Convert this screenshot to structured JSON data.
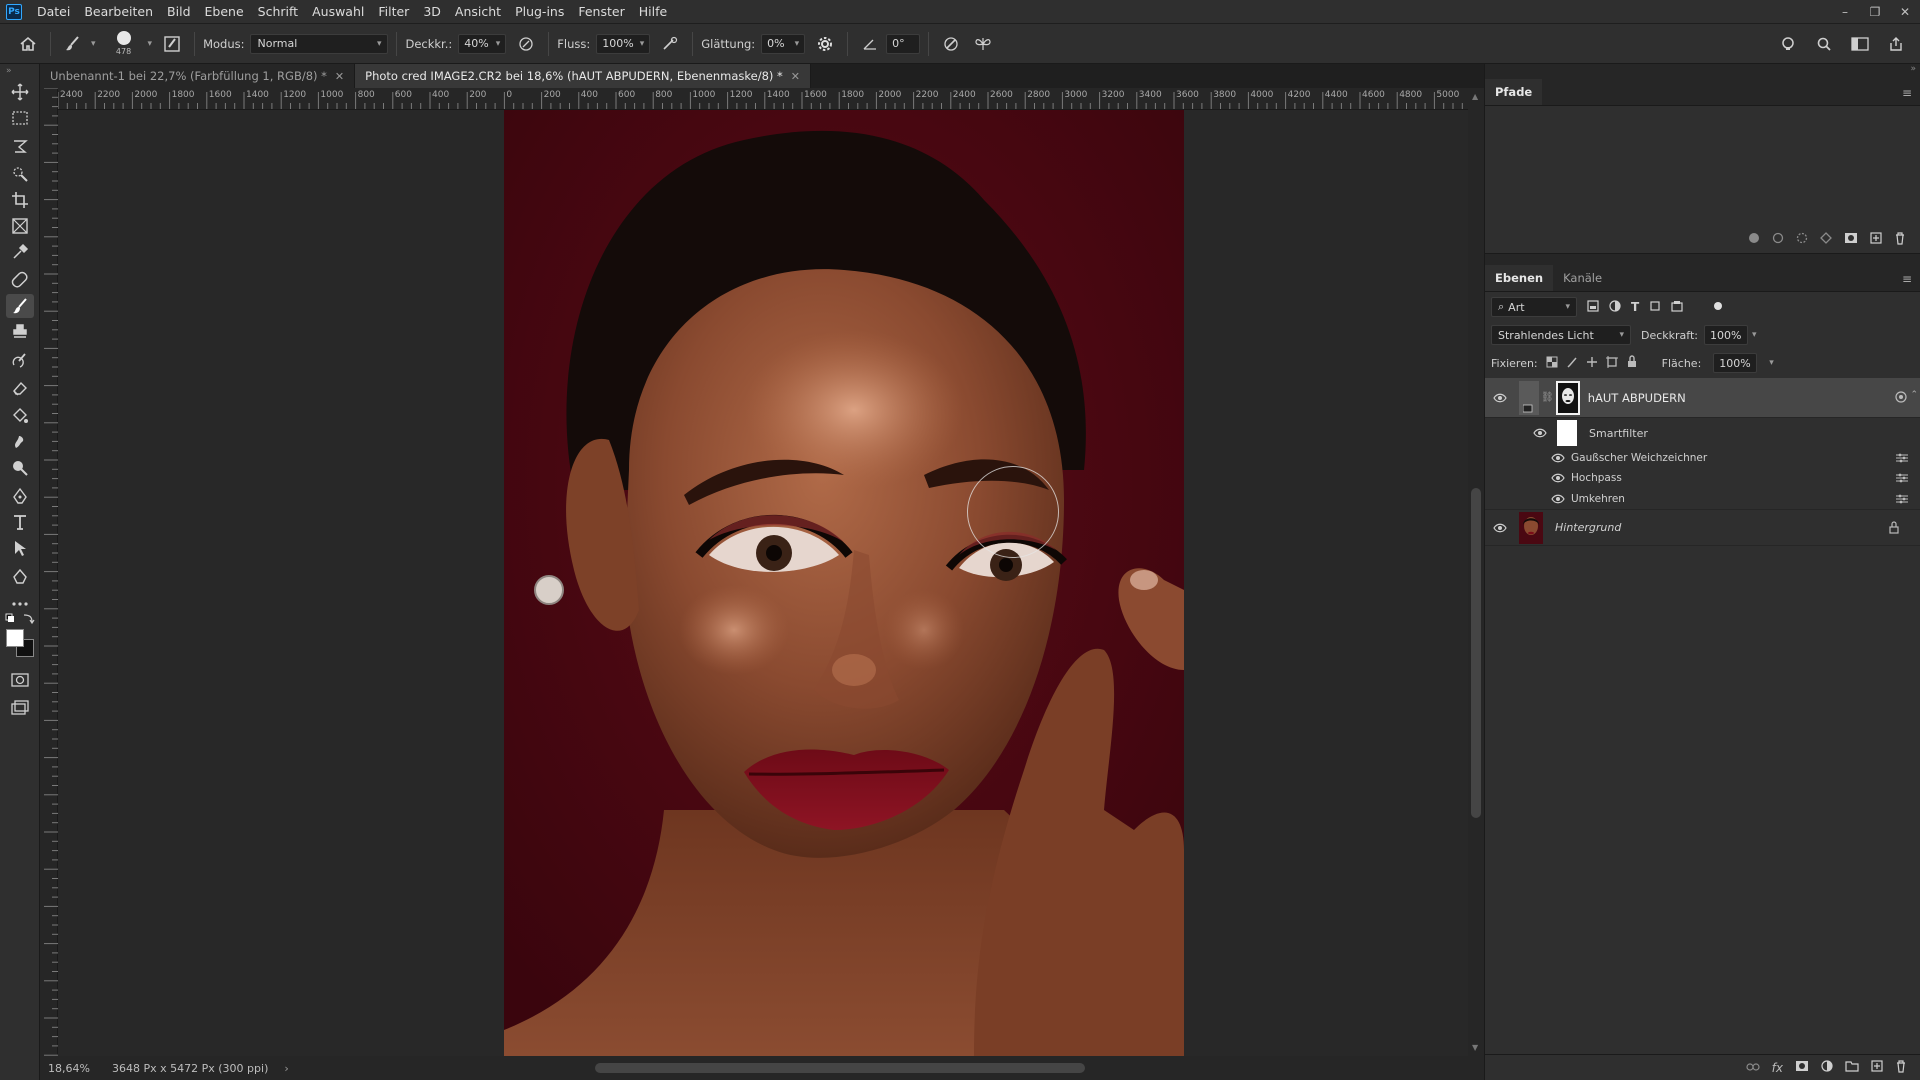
{
  "app": {
    "logo": "Ps"
  },
  "menu": [
    "Datei",
    "Bearbeiten",
    "Bild",
    "Ebene",
    "Schrift",
    "Auswahl",
    "Filter",
    "3D",
    "Ansicht",
    "Plug-ins",
    "Fenster",
    "Hilfe"
  ],
  "window_controls": {
    "minimize": "–",
    "restore": "❐",
    "close": "✕"
  },
  "options": {
    "brush_size": "478",
    "modus_label": "Modus:",
    "modus_value": "Normal",
    "deckkr_label": "Deckkr.:",
    "deckkr_value": "40%",
    "fluss_label": "Fluss:",
    "fluss_value": "100%",
    "glaettung_label": "Glättung:",
    "glaettung_value": "0%",
    "angle_value": "0°"
  },
  "tabs": [
    {
      "label": "Unbenannt-1 bei 22,7% (Farbfüllung 1, RGB/8) *",
      "active": false
    },
    {
      "label": "Photo cred IMAGE2.CR2 bei 18,6% (hAUT ABPUDERN, Ebenenmaske/8) *",
      "active": true
    }
  ],
  "ruler_labels": [
    "2400",
    "2200",
    "2000",
    "1800",
    "1600",
    "1400",
    "1200",
    "1000",
    "800",
    "600",
    "400",
    "200",
    "0",
    "200",
    "400",
    "600",
    "800",
    "1000",
    "1200",
    "1400",
    "1600",
    "1800",
    "2000",
    "2200",
    "2400",
    "2600",
    "2800",
    "3000",
    "3200",
    "3400",
    "3600",
    "3800",
    "4000",
    "4200",
    "4400",
    "4600",
    "4800",
    "5000"
  ],
  "status": {
    "zoom": "18,64%",
    "doc_size": "3648 Px x 5472 Px (300 ppi)",
    "arrow": "›"
  },
  "paths_panel": {
    "tab": "Pfade"
  },
  "layers_panel": {
    "tabs": [
      "Ebenen",
      "Kanäle"
    ],
    "filter_label": "Art",
    "blend_mode": "Strahlendes Licht",
    "opacity_label": "Deckkraft:",
    "opacity_value": "100%",
    "lock_label": "Fixieren:",
    "fill_label": "Fläche:",
    "fill_value": "100%",
    "layers": [
      {
        "name": "hAUT ABPUDERN"
      },
      {
        "name": "Smartfilter"
      },
      {
        "name": "Gaußscher Weichzeichner"
      },
      {
        "name": "Hochpass"
      },
      {
        "name": "Umkehren"
      },
      {
        "name": "Hintergrund"
      }
    ]
  },
  "colors": {
    "accent": "#31a8ff",
    "photo_bg": "#4a0812"
  }
}
